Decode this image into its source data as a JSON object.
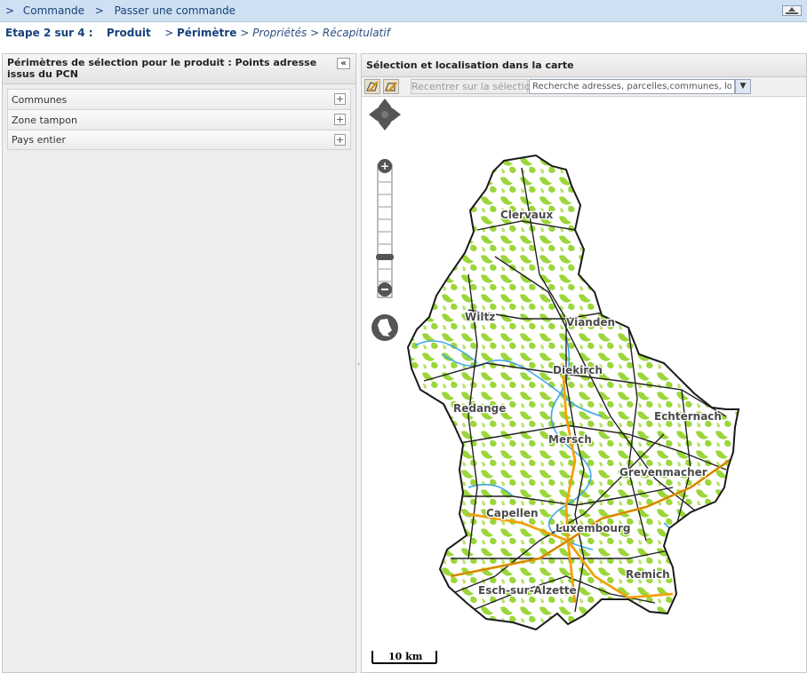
{
  "breadcrumb": {
    "prefix": ">",
    "items": [
      "Commande",
      "Passer une commande"
    ],
    "separator": ">"
  },
  "steps": {
    "label": "Etape 2 sur 4 :",
    "items": [
      {
        "label": "Produit",
        "prefix": "",
        "state": "done"
      },
      {
        "label": "Périmètre",
        "prefix": ">",
        "state": "current"
      },
      {
        "label": "Propriétés",
        "prefix": ">",
        "state": "todo"
      },
      {
        "label": "Récapitulatif",
        "prefix": ">",
        "state": "todo"
      }
    ]
  },
  "left_panel": {
    "title": "Périmètres de sélection pour le produit : Points adresse issus du PCN",
    "collapse_glyph": "«",
    "sections": [
      {
        "label": "Communes",
        "glyph": "+"
      },
      {
        "label": "Zone tampon",
        "glyph": "+"
      },
      {
        "label": "Pays entier",
        "glyph": "+"
      }
    ]
  },
  "map_panel": {
    "title": "Sélection et localisation dans la carte",
    "recenter_label": "Recentrer sur la sélection",
    "search_value": "Recherche adresses, parcelles,communes, loc",
    "search_trigger_glyph": "▼",
    "tool_icons": [
      "draw-polygon-icon",
      "edit-polygon-icon"
    ],
    "towns": [
      {
        "name": "Clervaux"
      },
      {
        "name": "Wiltz"
      },
      {
        "name": "Vianden"
      },
      {
        "name": "Diekirch"
      },
      {
        "name": "Redange"
      },
      {
        "name": "Echternach"
      },
      {
        "name": "Mersch"
      },
      {
        "name": "Grevenmacher"
      },
      {
        "name": "Capellen"
      },
      {
        "name": "Luxembourg"
      },
      {
        "name": "Remich"
      },
      {
        "name": "Esch-sur-Alzette"
      }
    ],
    "scale_label": "10 km"
  },
  "colors": {
    "forest": "#9bd63a",
    "roads": "#222222",
    "highways": "#f2a20c",
    "water": "#3fa9e6"
  }
}
